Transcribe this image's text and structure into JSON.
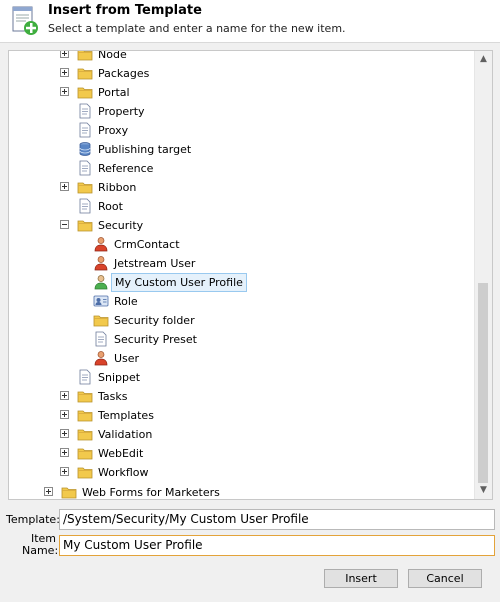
{
  "header": {
    "title": "Insert from Template",
    "subtitle": "Select a template and enter a name for the new item."
  },
  "tree": {
    "items": [
      {
        "label": "Node",
        "icon": "folder-icon",
        "expander": "plus"
      },
      {
        "label": "Packages",
        "icon": "folder-icon",
        "expander": "plus"
      },
      {
        "label": "Portal",
        "icon": "folder-icon",
        "expander": "plus"
      },
      {
        "label": "Property",
        "icon": "document-icon",
        "expander": "none"
      },
      {
        "label": "Proxy",
        "icon": "document-icon",
        "expander": "none"
      },
      {
        "label": "Publishing target",
        "icon": "database-icon",
        "expander": "none"
      },
      {
        "label": "Reference",
        "icon": "document-icon",
        "expander": "none"
      },
      {
        "label": "Ribbon",
        "icon": "folder-icon",
        "expander": "plus"
      },
      {
        "label": "Root",
        "icon": "document-icon",
        "expander": "none"
      },
      {
        "label": "Security",
        "icon": "folder-icon",
        "expander": "minus"
      },
      {
        "label": "CrmContact",
        "icon": "user-icon",
        "expander": "none"
      },
      {
        "label": "Jetstream User",
        "icon": "user-icon",
        "expander": "none"
      },
      {
        "label": "My Custom User Profile",
        "icon": "user-green-icon",
        "expander": "none",
        "selected": true
      },
      {
        "label": "Role",
        "icon": "role-icon",
        "expander": "none"
      },
      {
        "label": "Security folder",
        "icon": "folder-icon",
        "expander": "none"
      },
      {
        "label": "Security Preset",
        "icon": "document-icon",
        "expander": "none"
      },
      {
        "label": "User",
        "icon": "user-icon",
        "expander": "none"
      },
      {
        "label": "Snippet",
        "icon": "document-icon",
        "expander": "none"
      },
      {
        "label": "Tasks",
        "icon": "folder-icon",
        "expander": "plus"
      },
      {
        "label": "Templates",
        "icon": "folder-icon",
        "expander": "plus"
      },
      {
        "label": "Validation",
        "icon": "folder-icon",
        "expander": "plus"
      },
      {
        "label": "WebEdit",
        "icon": "folder-icon",
        "expander": "plus"
      },
      {
        "label": "Workflow",
        "icon": "folder-icon",
        "expander": "plus"
      },
      {
        "label": "Web Forms for Marketers",
        "icon": "folder-icon",
        "expander": "plus"
      }
    ]
  },
  "form": {
    "template_label": "Template:",
    "template_value": "/System/Security/My Custom User Profile",
    "item_name_label_line1": "Item",
    "item_name_label_line2": "Name:",
    "item_name_value": "My Custom User Profile"
  },
  "buttons": {
    "insert": "Insert",
    "cancel": "Cancel"
  },
  "colors": {
    "selection_bg": "#e5f1fb",
    "selection_border": "#99c9ef",
    "focus_border": "#e3a33a",
    "folder": "#f2c94c"
  }
}
